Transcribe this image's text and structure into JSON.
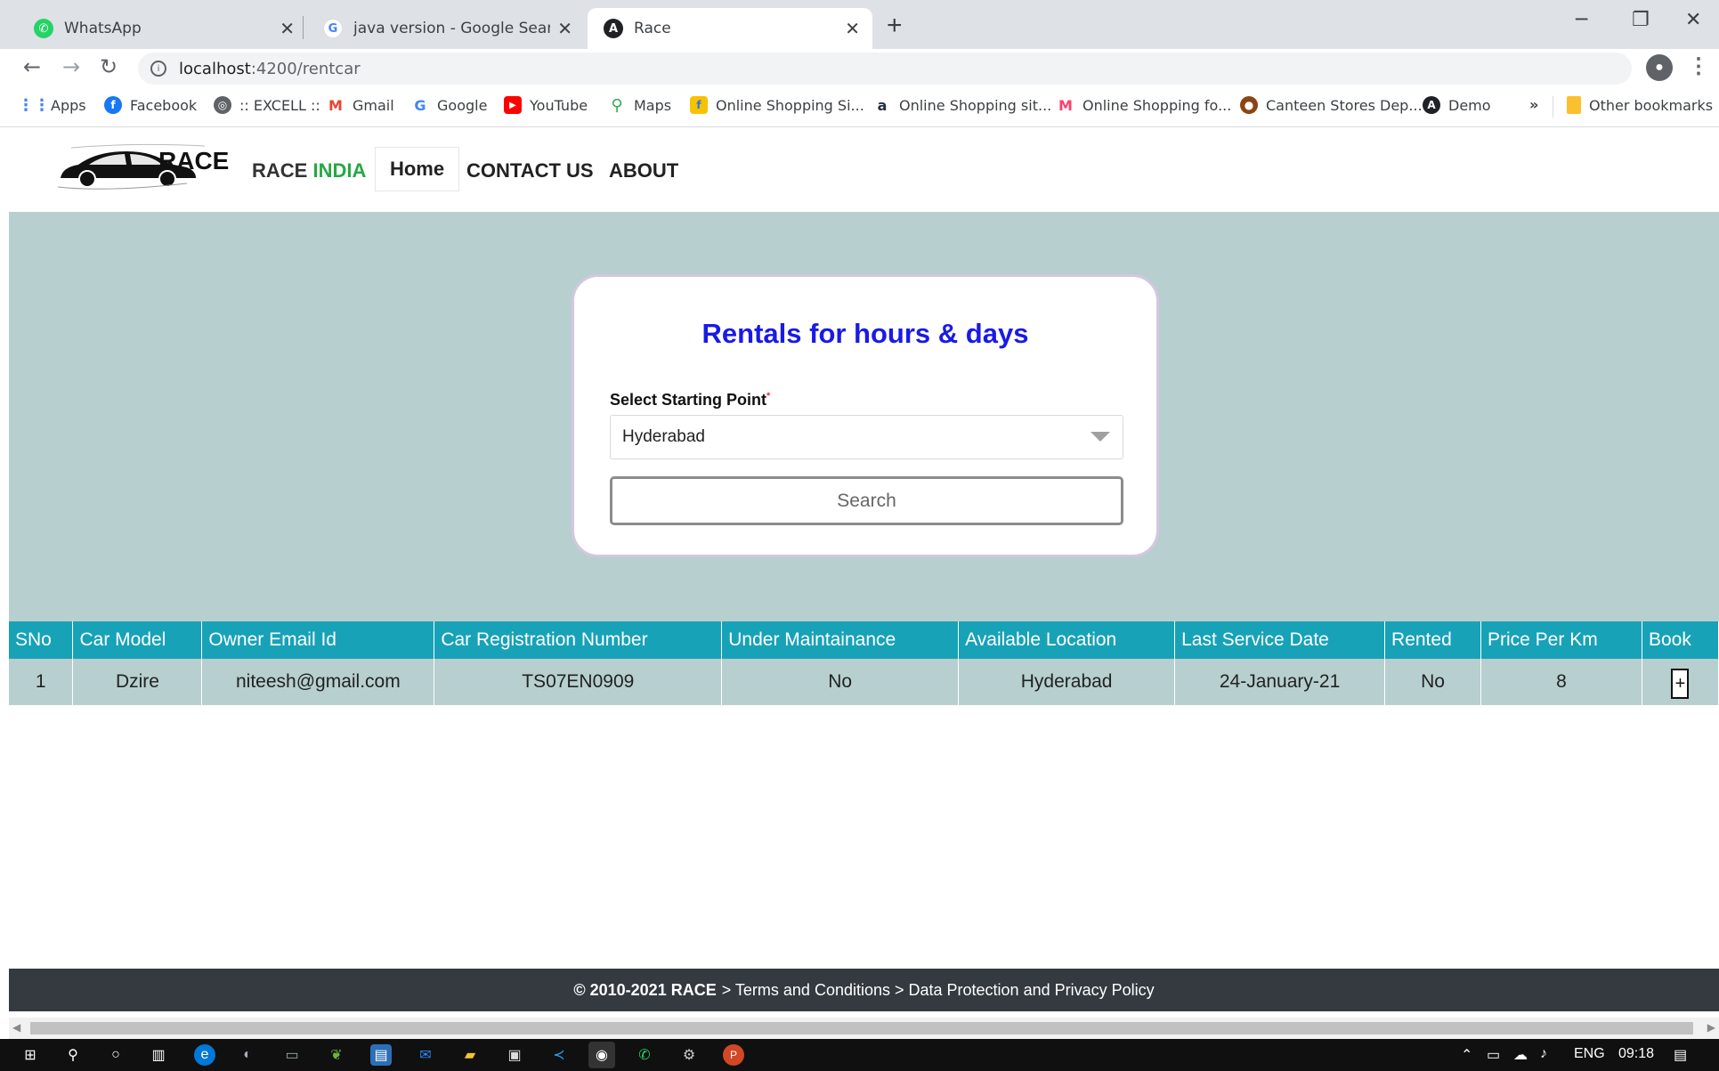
{
  "browser": {
    "tabs": [
      {
        "title": "WhatsApp",
        "icon": "whatsapp-icon",
        "color": "#25d366"
      },
      {
        "title": "java version - Google Search",
        "icon": "google-icon",
        "color": "#4285f4"
      },
      {
        "title": "Race",
        "icon": "angular-icon",
        "color": "#202124"
      }
    ],
    "url_host": "localhost",
    "url_rest": ":4200/rentcar",
    "bookmarks": [
      {
        "label": "Apps",
        "icon": "apps-grid-icon",
        "color": "#4285f4"
      },
      {
        "label": "Facebook",
        "icon": "facebook-icon",
        "color": "#1877f2"
      },
      {
        "label": ":: EXCELL ::",
        "icon": "globe-icon",
        "color": "#5f6368"
      },
      {
        "label": "Gmail",
        "icon": "gmail-icon",
        "color": "#ea4335"
      },
      {
        "label": "Google",
        "icon": "google-icon",
        "color": "#4285f4"
      },
      {
        "label": "YouTube",
        "icon": "youtube-icon",
        "color": "#ff0000"
      },
      {
        "label": "Maps",
        "icon": "maps-pin-icon",
        "color": "#34a853"
      },
      {
        "label": "Online Shopping Si...",
        "icon": "flipkart-icon",
        "color": "#f7c200"
      },
      {
        "label": "Online Shopping sit...",
        "icon": "amazon-icon",
        "color": "#232f3e"
      },
      {
        "label": "Online Shopping fo...",
        "icon": "myntra-icon",
        "color": "#ff3f6c"
      },
      {
        "label": "Canteen Stores Dep...",
        "icon": "canteen-icon",
        "color": "#8b4513"
      },
      {
        "label": "Demo",
        "icon": "angular-icon",
        "color": "#202124"
      }
    ],
    "more_bookmarks": "»",
    "other_bookmarks": "Other bookmarks"
  },
  "nav": {
    "logo_text": "RACE",
    "brand_race": "RACE",
    "brand_india": "INDIA",
    "home": "Home",
    "contact": "CONTACT US",
    "about": "ABOUT"
  },
  "search_card": {
    "title": "Rentals for hours & days",
    "label": "Select Starting Point",
    "required_mark": "*",
    "selected": "Hyderabad",
    "button": "Search"
  },
  "table": {
    "headers": [
      "SNo",
      "Car Model",
      "Owner Email Id",
      "Car Registration Number",
      "Under Maintainance",
      "Available Location",
      "Last Service Date",
      "Rented",
      "Price Per Km",
      "Book"
    ],
    "rows": [
      {
        "sno": "1",
        "model": "Dzire",
        "email": "niteesh@gmail.com",
        "reg": "TS07EN0909",
        "maintenance": "No",
        "location": "Hyderabad",
        "service_date": "24-January-21",
        "rented": "No",
        "price": "8",
        "book": "+"
      }
    ]
  },
  "footer": {
    "copyright": "© 2010-2021 RACE",
    "links": "> Terms and Conditions > Data Protection and Privacy Policy"
  },
  "taskbar": {
    "language": "ENG",
    "time": "09:18"
  },
  "colors": {
    "accent_blue": "#1a1ae6",
    "table_header": "#17a2b8",
    "hero_bg": "#b7cfcf",
    "footer_bg": "#343a40",
    "brand_green": "#28a745"
  }
}
